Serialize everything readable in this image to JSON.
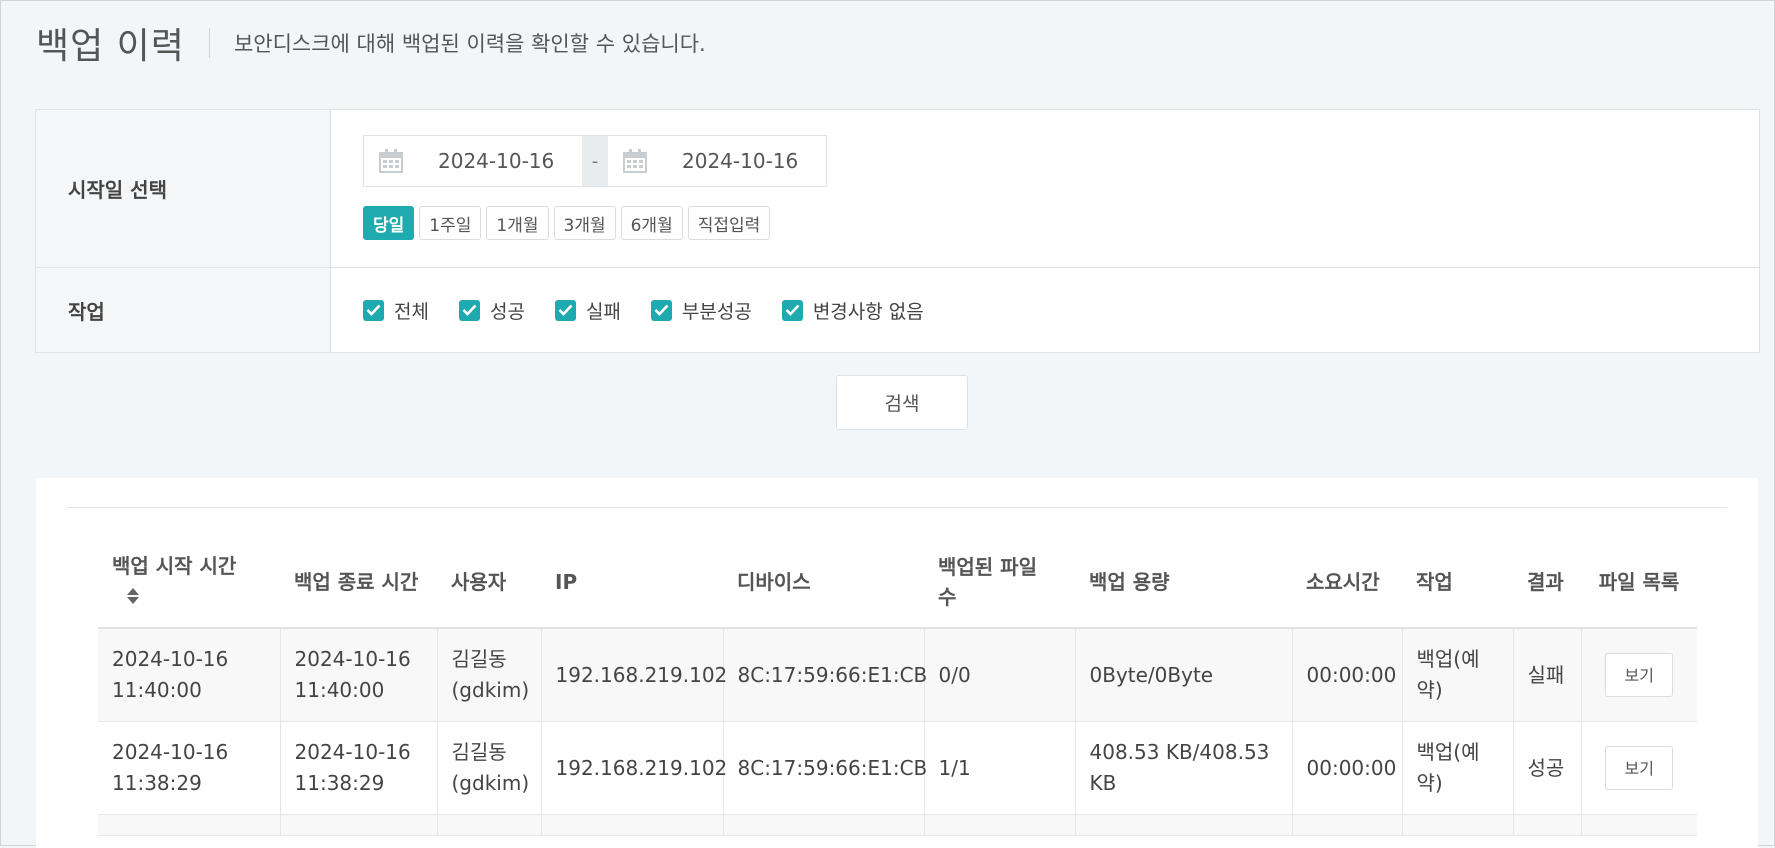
{
  "header": {
    "title": "백업 이력",
    "description": "보안디스크에 대해 백업된 이력을 확인할 수 있습니다."
  },
  "filter": {
    "date_label": "시작일 선택",
    "start_date": "2024-10-16",
    "end_date": "2024-10-16",
    "date_separator": "-",
    "quick_ranges": [
      "당일",
      "1주일",
      "1개월",
      "3개월",
      "6개월",
      "직접입력"
    ],
    "active_range": "당일",
    "task_label": "작업",
    "task_options": [
      {
        "label": "전체",
        "checked": true
      },
      {
        "label": "성공",
        "checked": true
      },
      {
        "label": "실패",
        "checked": true
      },
      {
        "label": "부분성공",
        "checked": true
      },
      {
        "label": "변경사항 없음",
        "checked": true
      }
    ],
    "search_label": "검색"
  },
  "table": {
    "columns": [
      "백업 시작 시간",
      "백업 종료 시간",
      "사용자",
      "IP",
      "디바이스",
      "백업된 파일 수",
      "백업 용량",
      "소요시간",
      "작업",
      "결과",
      "파일 목록"
    ],
    "rows": [
      {
        "start_date": "2024-10-16",
        "start_time": "11:40:00",
        "end_date": "2024-10-16",
        "end_time": "11:40:00",
        "user_name": "김길동",
        "user_id": "(gdkim)",
        "ip": "192.168.219.102",
        "device": "8C:17:59:66:E1:CB",
        "files": "0/0",
        "size": "0Byte/0Byte",
        "duration": "00:00:00",
        "task": "백업(예약)",
        "result": "실패",
        "action": "보기"
      },
      {
        "start_date": "2024-10-16",
        "start_time": "11:38:29",
        "end_date": "2024-10-16",
        "end_time": "11:38:29",
        "user_name": "김길동",
        "user_id": "(gdkim)",
        "ip": "192.168.219.102",
        "device": "8C:17:59:66:E1:CB",
        "files": "1/1",
        "size": "408.53 KB/408.53 KB",
        "duration": "00:00:00",
        "task": "백업(예약)",
        "result": "성공",
        "action": "보기"
      }
    ]
  },
  "colors": {
    "accent": "#1faab0",
    "background": "#f3f6f8"
  },
  "icons": {
    "calendar": "calendar-icon",
    "check": "checkmark-icon",
    "sort": "sort-icon"
  }
}
